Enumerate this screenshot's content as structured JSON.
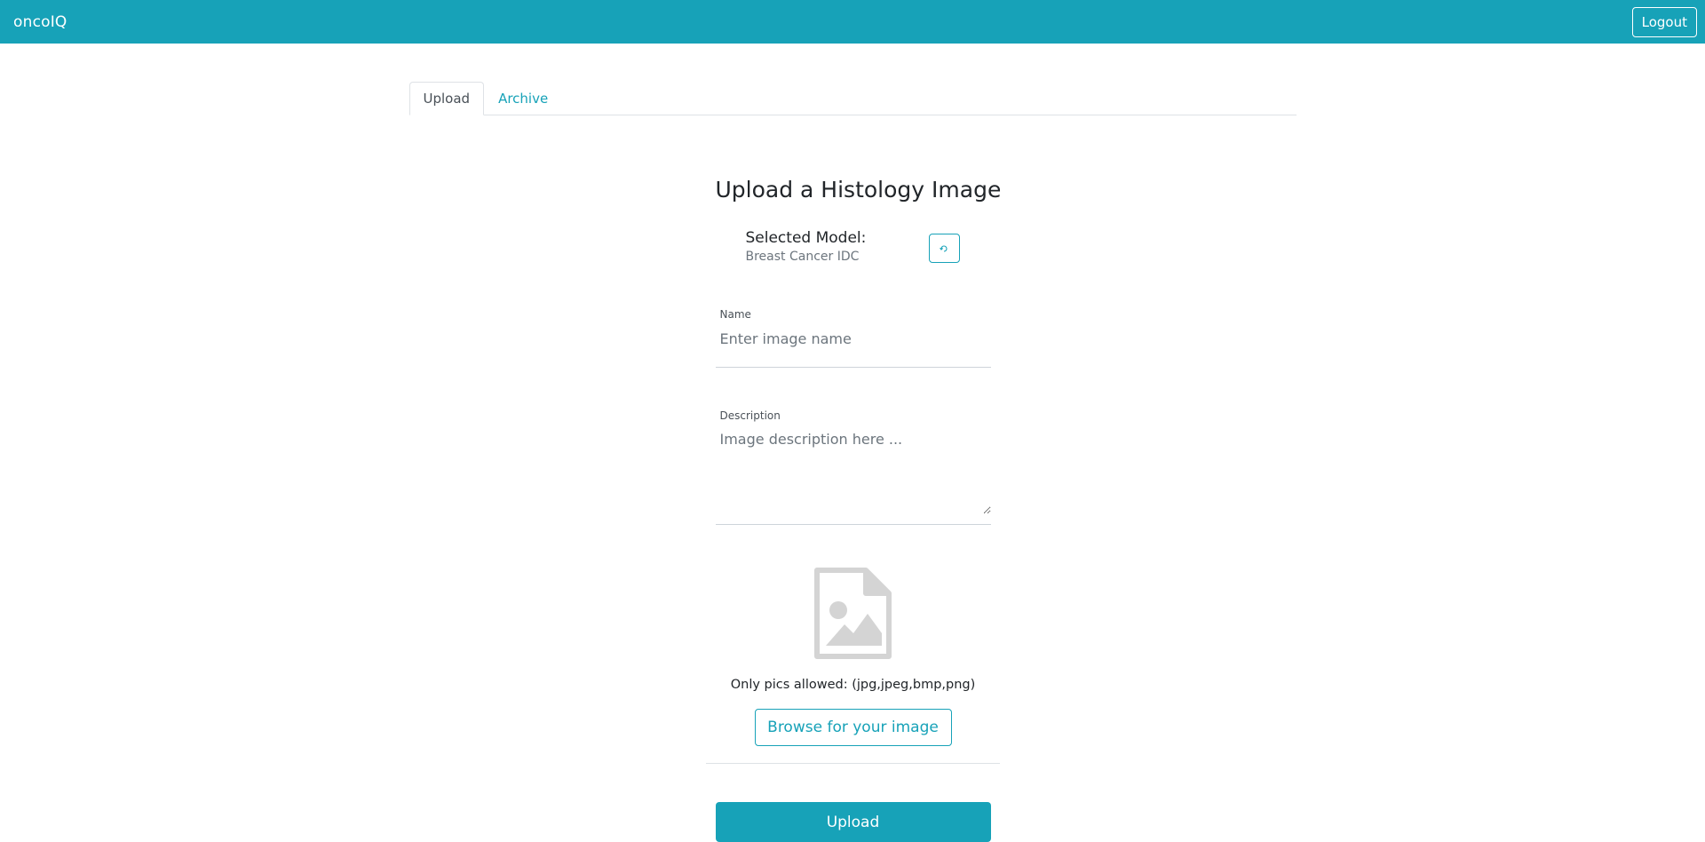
{
  "navbar": {
    "brand": "oncoIQ",
    "logout_label": "Logout"
  },
  "tabs": [
    {
      "label": "Upload",
      "active": true
    },
    {
      "label": "Archive",
      "active": false
    }
  ],
  "form": {
    "title": "Upload a Histology Image",
    "model_label": "Selected Model:",
    "model_value": "Breast Cancer IDC",
    "change_model_icon": "undo-icon",
    "name_label": "Name",
    "name_value": "",
    "name_placeholder": "Enter image name",
    "description_label": "Description",
    "description_value": "",
    "description_placeholder": "Image description here ...",
    "file_icon": "image-file-icon",
    "allowed_text": "Only pics allowed: (jpg,jpeg,bmp,png)",
    "browse_label": "Browse for your image",
    "upload_label": "Upload"
  },
  "colors": {
    "accent": "#17a2b8",
    "icon_gray": "#d4d4d4"
  }
}
